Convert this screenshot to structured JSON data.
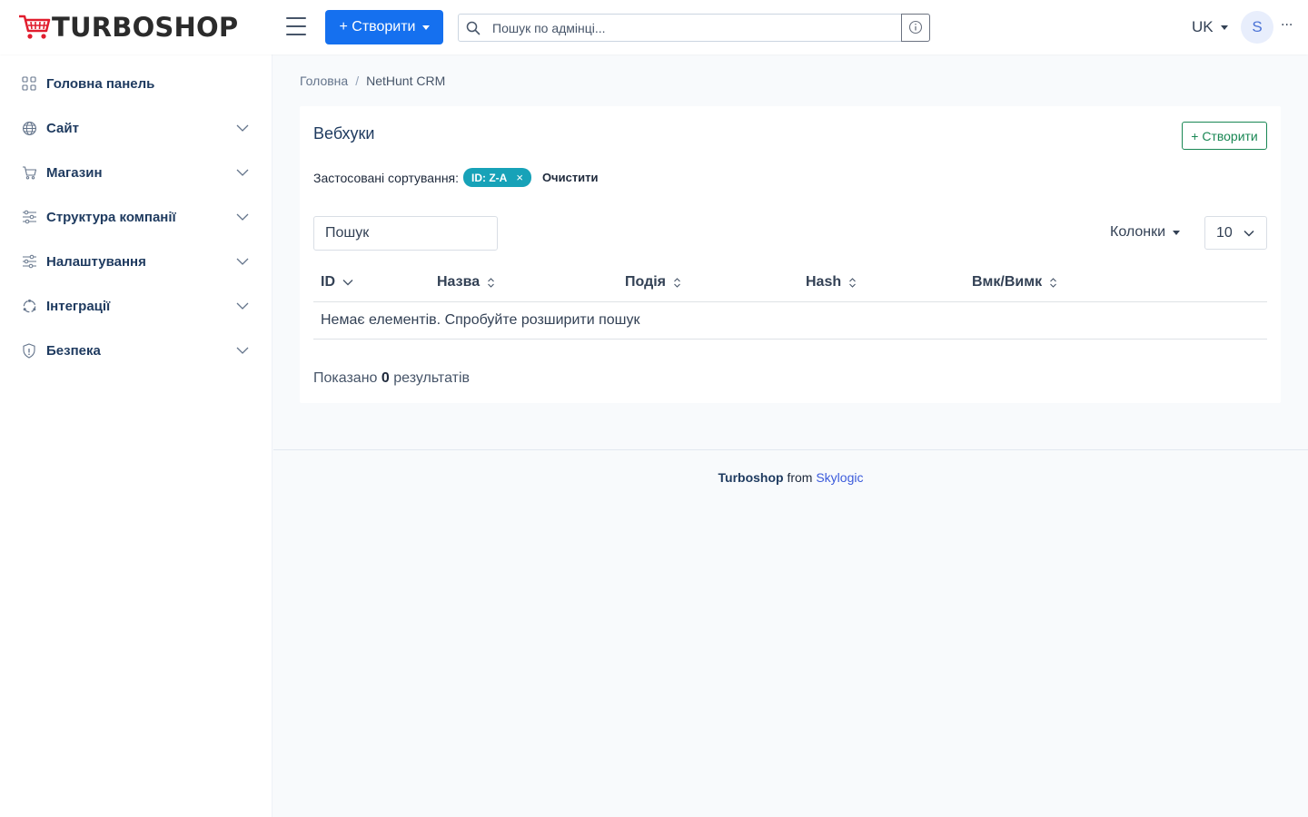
{
  "app": {
    "logo_text": "TURBOSHOP",
    "brand_color": "#e11d2e"
  },
  "header": {
    "create_label": "+ Створити",
    "search_placeholder": "Пошук по адмінці...",
    "lang": "UK",
    "avatar_initial": "S",
    "more_label": "···",
    "accent": "#1570ef"
  },
  "sidebar": {
    "items": [
      {
        "label": "Головна панель",
        "icon": "dashboard-grid-icon"
      },
      {
        "label": "Сайт",
        "icon": "globe-icon"
      },
      {
        "label": "Магазин",
        "icon": "cart-icon"
      },
      {
        "label": "Структура компанії",
        "icon": "structure-sliders-icon"
      },
      {
        "label": "Налаштування",
        "icon": "settings-sliders-icon"
      },
      {
        "label": "Інтеграції",
        "icon": "integrations-sync-icon"
      },
      {
        "label": "Безпека",
        "icon": "shield-icon"
      }
    ]
  },
  "breadcrumb": {
    "home": "Головна",
    "separator": "/",
    "current": "NetHunt CRM"
  },
  "card": {
    "title": "Вебхуки",
    "create_label": "+ Створити",
    "sort_label": "Застосовані сортування:",
    "sort_chip": "ID: Z-A",
    "sort_chip_close": "×",
    "clear_label": "Очистити",
    "search_placeholder": "Пошук",
    "columns_label": "Колонки",
    "per_page": "10",
    "columns": [
      "ID",
      "Назва",
      "Подія",
      "Hash",
      "Вмк/Вимк"
    ],
    "empty_text": "Немає елементів. Спробуйте розширити пошук",
    "results_prefix": "Показано",
    "results_count": "0",
    "results_suffix": "результатів",
    "outline_color": "#198754",
    "chip_color": "#17a2b8"
  },
  "footer": {
    "brand": "Turboshop",
    "from": "from",
    "company": "Skylogic"
  }
}
